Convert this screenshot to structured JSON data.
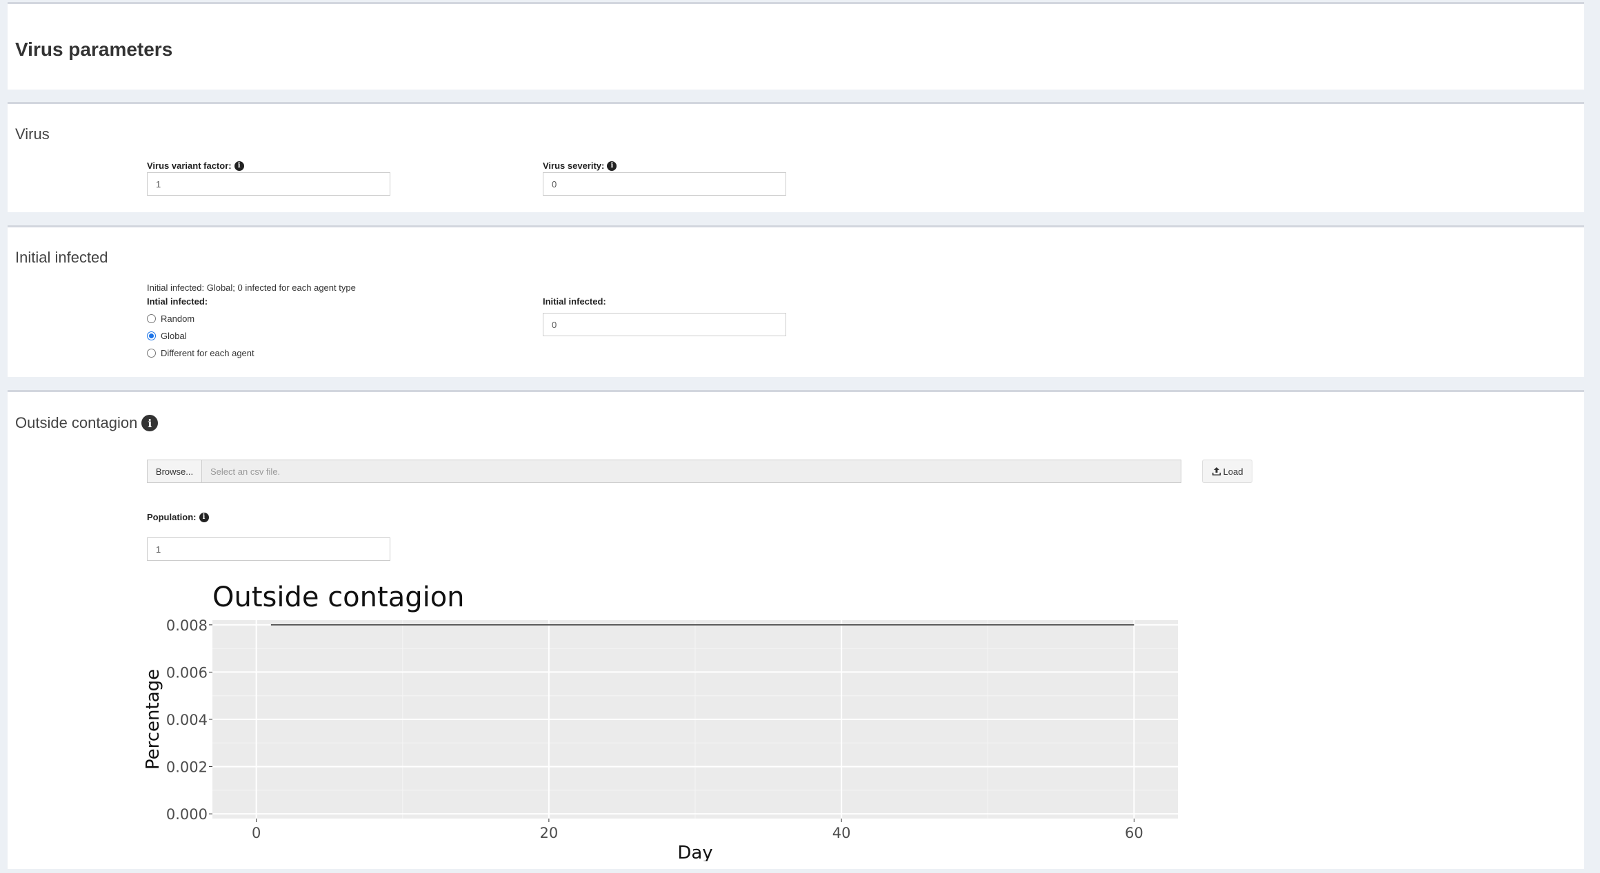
{
  "page": {
    "title": "Virus parameters"
  },
  "virus": {
    "title": "Virus",
    "variant_factor_label": "Virus variant factor:",
    "variant_factor_value": "1",
    "severity_label": "Virus severity:",
    "severity_value": "0"
  },
  "initial_infected": {
    "title": "Initial infected",
    "summary": "Initial infected: Global; 0 infected for each agent type",
    "radio_label": "Intial infected:",
    "options": [
      "Random",
      "Global",
      "Different for each agent"
    ],
    "selected": "Global",
    "count_label": "Initial infected:",
    "count_value": "0"
  },
  "outside_contagion": {
    "title": "Outside contagion",
    "browse_label": "Browse...",
    "file_placeholder": "Select an csv file.",
    "load_label": "Load",
    "population_label": "Population:",
    "population_value": "1"
  },
  "chart_data": {
    "type": "line",
    "title": "Outside contagion",
    "xlabel": "Day",
    "ylabel": "Percentage",
    "xlim": [
      -3,
      63
    ],
    "ylim": [
      -0.0002,
      0.0082
    ],
    "x_ticks": [
      0,
      20,
      40,
      60
    ],
    "y_ticks": [
      0.0,
      0.002,
      0.004,
      0.006,
      0.008
    ],
    "y_tick_labels": [
      "0.000",
      "0.002",
      "0.004",
      "0.006",
      "0.008"
    ],
    "grid": true,
    "background": "#ebebeb",
    "series": [
      {
        "x": [
          1,
          60
        ],
        "y": [
          0.008,
          0.008
        ],
        "color": "#333333"
      }
    ]
  },
  "colors": {
    "radio_accent": "#1a73e8",
    "box_border": "#d2d6de",
    "page_bg": "#ecf0f5"
  }
}
